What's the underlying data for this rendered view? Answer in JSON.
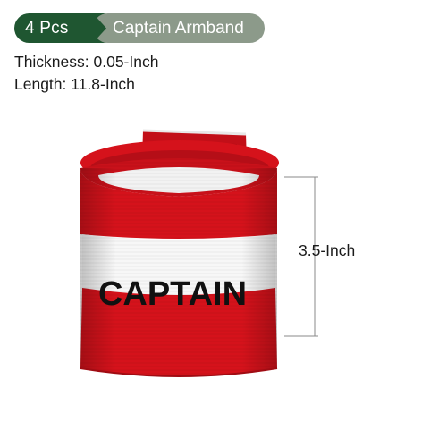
{
  "badge": {
    "quantity": "4 Pcs",
    "title": "Captain Armband",
    "quantity_color": "#1f5631",
    "title_color": "#8c9a8a"
  },
  "specs": {
    "thickness": "Thickness: 0.05-Inch",
    "length": "Length: 11.8-Inch"
  },
  "product": {
    "band_text": "CAPTAIN",
    "band_color": "#d5121b",
    "stripe_color": "#ffffff"
  },
  "dimension": {
    "height_label": "3.5-Inch"
  }
}
